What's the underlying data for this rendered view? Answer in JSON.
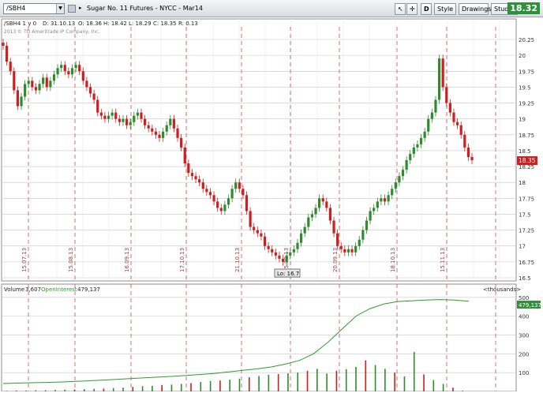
{
  "toolbar": {
    "symbol": "/SBH4",
    "description": "Sugar No. 11 Futures - NYCC - Mar14",
    "period_button": "D",
    "style_label": "Style",
    "drawings_label": "Drawings",
    "studies_label": "Studies",
    "last_price": "18.32"
  },
  "price_panel": {
    "header": {
      "symbol_label": "/SBH4 1 y 0",
      "date": "D: 31.10.13",
      "open": "O: 18.36",
      "high": "H: 18.42",
      "low": "L: 18.29",
      "close": "C: 18.35",
      "range": "R: 0.13"
    },
    "copyright": "2013 © TD Ameritrade IP Company, Inc.",
    "low_label": "Lo: 16.7",
    "current_price_label": "18.35"
  },
  "volume_panel": {
    "header": {
      "volume_label": "Volume",
      "volume_value": "3,607",
      "oi_label": "OpenInterest",
      "oi_value": "479,137",
      "units": "<thousands>"
    },
    "oi_tag": "479,137"
  },
  "colors": {
    "up": "#2e8b2e",
    "down": "#cc1f1f",
    "oi_line": "#2f9b2f",
    "grid": "#c8c8c8",
    "event_line": "#c85050",
    "price_tag": "#cc1f1f",
    "oi_tag": "#2f8f3a"
  },
  "chart_data": [
    {
      "type": "candlestick",
      "title": "Sugar No. 11 Futures - NYCC - Mar14",
      "y_ticks": [
        20.25,
        20,
        19.75,
        19.5,
        19.25,
        19,
        18.75,
        18.5,
        18.25,
        18,
        17.75,
        17.5,
        17.25,
        17,
        16.75,
        16.5
      ],
      "ylim": [
        16.5,
        20.25
      ],
      "grid": true,
      "date_markers": [
        "15.07.13",
        "15.08.13",
        "16.09.13",
        "17.10.13",
        "21.10.13",
        "15.08.13",
        "20.09.13",
        "18.10.13",
        "15.11.13"
      ],
      "closes": [
        20.15,
        19.9,
        19.75,
        19.45,
        19.2,
        19.35,
        19.55,
        19.6,
        19.5,
        19.45,
        19.55,
        19.65,
        19.5,
        19.6,
        19.7,
        19.8,
        19.85,
        19.75,
        19.7,
        19.8,
        19.85,
        19.75,
        19.6,
        19.5,
        19.4,
        19.3,
        19.1,
        19.05,
        19.0,
        19.05,
        19.1,
        19.0,
        18.95,
        19.0,
        18.9,
        18.95,
        19.05,
        19.1,
        19.0,
        18.9,
        18.85,
        18.8,
        18.75,
        18.7,
        18.8,
        18.9,
        19.0,
        18.85,
        18.7,
        18.55,
        18.3,
        18.15,
        18.1,
        18.05,
        18.0,
        17.9,
        17.85,
        17.8,
        17.7,
        17.6,
        17.55,
        17.65,
        17.75,
        17.9,
        18.0,
        17.9,
        17.8,
        17.55,
        17.3,
        17.25,
        17.2,
        17.15,
        17.0,
        16.95,
        16.9,
        16.85,
        16.8,
        16.75,
        16.85,
        16.9,
        16.95,
        17.05,
        17.2,
        17.3,
        17.45,
        17.5,
        17.6,
        17.75,
        17.7,
        17.6,
        17.4,
        17.2,
        17.0,
        16.95,
        16.9,
        16.95,
        16.9,
        17.0,
        17.1,
        17.25,
        17.4,
        17.55,
        17.6,
        17.7,
        17.75,
        17.7,
        17.8,
        17.9,
        18.0,
        18.1,
        18.2,
        18.35,
        18.45,
        18.55,
        18.6,
        18.7,
        18.8,
        19.0,
        19.1,
        19.3,
        19.95,
        19.5,
        19.25,
        19.1,
        18.95,
        18.9,
        18.75,
        18.55,
        18.4,
        18.35
      ],
      "low": 16.7
    },
    {
      "type": "bar+line",
      "series": [
        {
          "name": "Volume",
          "last": 3607
        },
        {
          "name": "OpenInterest",
          "last": 479137
        }
      ],
      "y_ticks": [
        100,
        200,
        300,
        400,
        500
      ],
      "ylim": [
        0,
        520
      ],
      "oi_thousands": [
        42,
        44,
        46,
        48,
        50,
        53,
        56,
        60,
        64,
        68,
        72,
        76,
        80,
        85,
        90,
        96,
        104,
        112,
        120,
        130,
        145,
        165,
        200,
        260,
        330,
        400,
        440,
        465,
        478,
        482,
        486,
        488,
        485,
        479
      ],
      "volume_thousands": [
        3,
        4,
        5,
        6,
        6,
        8,
        9,
        10,
        12,
        14,
        15,
        18,
        20,
        24,
        28,
        30,
        34,
        36,
        40,
        44,
        50,
        55,
        58,
        62,
        68,
        75,
        82,
        88,
        92,
        96,
        100,
        110,
        120,
        95,
        110,
        118,
        130,
        165,
        140,
        120,
        100,
        80,
        210,
        90,
        60,
        40,
        20,
        4
      ]
    }
  ]
}
